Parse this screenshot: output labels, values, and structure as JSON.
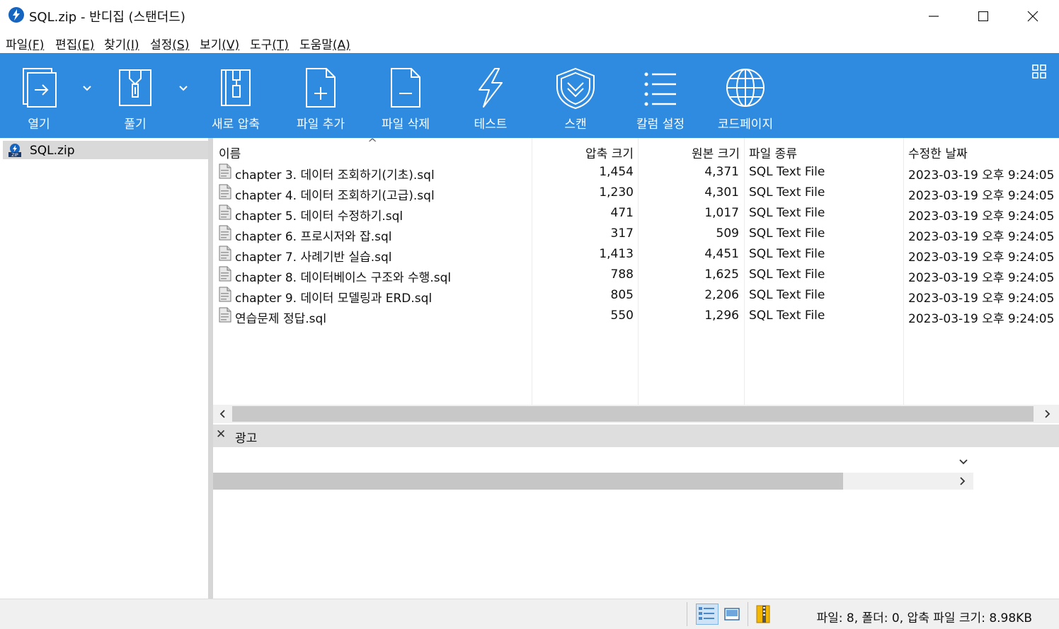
{
  "window": {
    "title": "SQL.zip - 반디집 (스탠더드)",
    "minimize": "—",
    "maximize": "☐",
    "close": "✕"
  },
  "menu": [
    {
      "label": "파일",
      "accel": "(F)"
    },
    {
      "label": "편집",
      "accel": "(E)"
    },
    {
      "label": "찾기",
      "accel": "(I)"
    },
    {
      "label": "설정",
      "accel": "(S)"
    },
    {
      "label": "보기",
      "accel": "(V)"
    },
    {
      "label": "도구",
      "accel": "(T)"
    },
    {
      "label": "도움말",
      "accel": "(A)"
    }
  ],
  "toolbar": {
    "open": "열기",
    "extract": "풀기",
    "new_archive": "새로 압축",
    "add_file": "파일 추가",
    "delete_file": "파일 삭제",
    "test": "테스트",
    "scan": "스캔",
    "column_settings": "칼럼 설정",
    "codepage": "코드페이지",
    "accent_color": "#2f8be0"
  },
  "tree": {
    "root": "SQL.zip"
  },
  "list": {
    "columns": {
      "name": "이름",
      "compressed": "압축 크기",
      "original": "원본 크기",
      "type": "파일 종류",
      "modified": "수정한 날짜"
    },
    "sort_indicator": "^",
    "rows": [
      {
        "name": "chapter 3. 데이터 조회하기(기초).sql",
        "compressed": "1,454",
        "original": "4,371",
        "type": "SQL Text File",
        "modified": "2023-03-19 오후 9:24:05"
      },
      {
        "name": "chapter 4. 데이터 조회하기(고급).sql",
        "compressed": "1,230",
        "original": "4,301",
        "type": "SQL Text File",
        "modified": "2023-03-19 오후 9:24:05"
      },
      {
        "name": "chapter 5. 데이터 수정하기.sql",
        "compressed": "471",
        "original": "1,017",
        "type": "SQL Text File",
        "modified": "2023-03-19 오후 9:24:05"
      },
      {
        "name": "chapter 6. 프로시저와 잡.sql",
        "compressed": "317",
        "original": "509",
        "type": "SQL Text File",
        "modified": "2023-03-19 오후 9:24:05"
      },
      {
        "name": "chapter 7. 사례기반 실습.sql",
        "compressed": "1,413",
        "original": "4,451",
        "type": "SQL Text File",
        "modified": "2023-03-19 오후 9:24:05"
      },
      {
        "name": "chapter 8. 데이터베이스 구조와 수행.sql",
        "compressed": "788",
        "original": "1,625",
        "type": "SQL Text File",
        "modified": "2023-03-19 오후 9:24:05"
      },
      {
        "name": "chapter 9. 데이터 모델링과 ERD.sql",
        "compressed": "805",
        "original": "2,206",
        "type": "SQL Text File",
        "modified": "2023-03-19 오후 9:24:05"
      },
      {
        "name": "연습문제 정답.sql",
        "compressed": "550",
        "original": "1,296",
        "type": "SQL Text File",
        "modified": "2023-03-19 오후 9:24:05"
      }
    ]
  },
  "ad": {
    "close": "✕",
    "label": "광고"
  },
  "status": {
    "summary": "파일: 8, 폴더: 0, 압축 파일 크기: 8.98KB"
  }
}
